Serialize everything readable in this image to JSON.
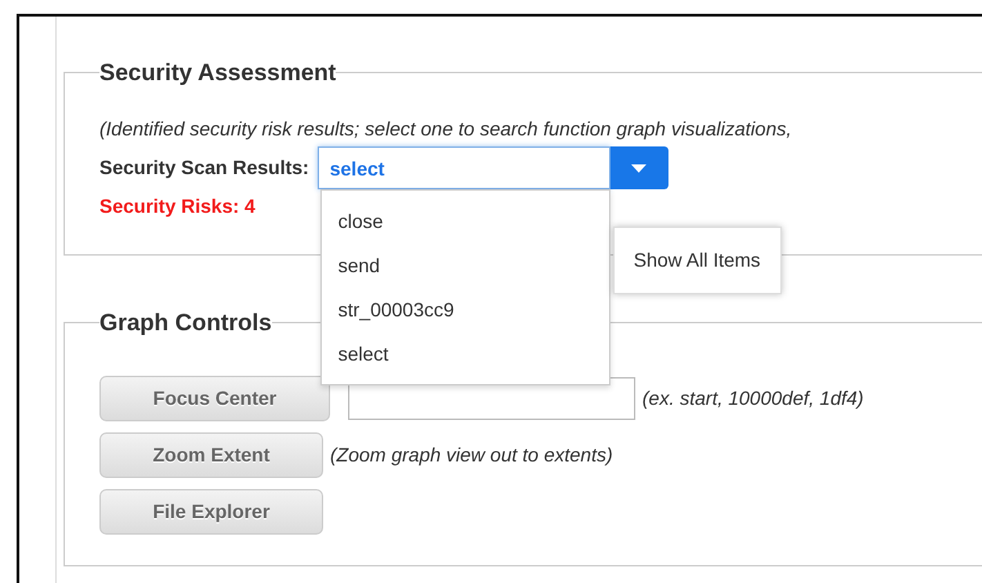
{
  "security_assessment": {
    "title": "Security Assessment",
    "description": "(Identified security risk results; select one to search function graph visualizations,",
    "scan_results": {
      "label": "Security Scan Results:",
      "value": "select",
      "expanded": true,
      "options": [
        "close",
        "send",
        "str_00003cc9",
        "select"
      ]
    },
    "risks": "Security Risks: 4",
    "tooltip": "Show All Items"
  },
  "graph_controls": {
    "title": "Graph Controls",
    "rows": [
      {
        "kind": "button-field",
        "button": "Focus Center",
        "hint": "(ex. start, 10000def, 1df4)"
      },
      {
        "kind": "button-hint",
        "button": "Zoom Extent",
        "hint": "(Zoom graph view out to extents)"
      },
      {
        "kind": "button",
        "button": "File Explorer"
      }
    ]
  }
}
